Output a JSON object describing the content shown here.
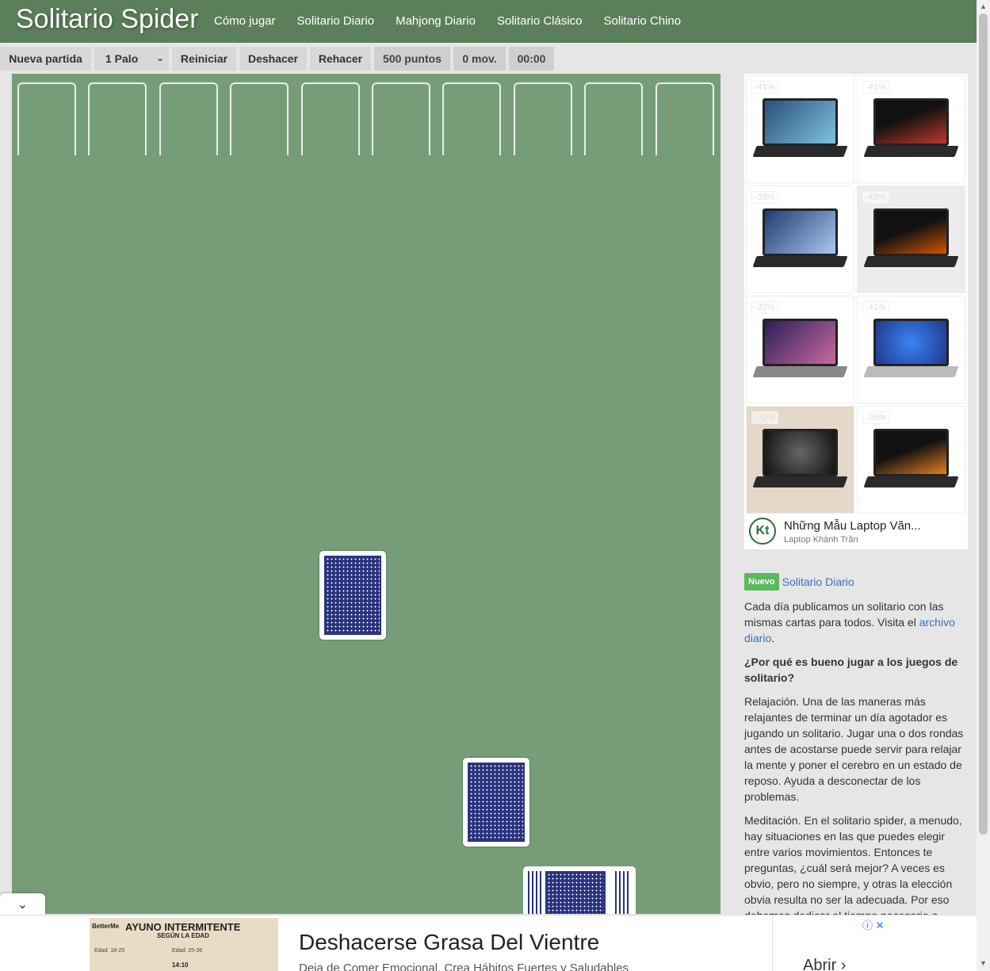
{
  "header": {
    "logo": "Solitario Spider",
    "nav": [
      "Cómo jugar",
      "Solitario Diario",
      "Mahjong Diario",
      "Solitario Clásico",
      "Solitario Chino"
    ]
  },
  "toolbar": {
    "new_game": "Nueva partida",
    "suit_select": "1 Palo",
    "restart": "Reiniciar",
    "undo": "Deshacer",
    "redo": "Rehacer",
    "score": "500 puntos",
    "moves": "0 mov.",
    "timer": "00:00"
  },
  "board": {
    "columns": 10,
    "background": "#779d78",
    "card_back": "#2a3480"
  },
  "side_ad": {
    "discounts": [
      "-41%",
      "-41%",
      "-38%",
      "-43%",
      "-37%",
      "-41%",
      "-32%",
      "-35%"
    ],
    "title": "Những Mẫu Laptop Văn...",
    "advertiser": "Laptop Khánh Trần",
    "logo_text": "Kt"
  },
  "article": {
    "badge": "Nuevo",
    "link_title": "Solitario Diario",
    "intro_before": "Cada día publicamos un solitario con las mismas cartas para todos. Visita el ",
    "intro_link": "archivo diario",
    "intro_after": ".",
    "heading": "¿Por qué es bueno jugar a los juegos de solitario?",
    "p1": "Relajación. Una de las maneras más relajantes de terminar un día agotador es jugando un solitario. Jugar una o dos rondas antes de acostarse puede servir para relajar la mente y poner el cerebro en un estado de reposo. Ayuda a desconectar de los problemas.",
    "p2": "Meditación. En el solitario spider, a menudo, hay situaciones en las que puedes elegir entre varios movimientos. Entonces te preguntas, ¿cuál será mejor? A veces es obvio, pero no siempre, y otras la elección obvia resulta no ser la adecuada. Por eso debemos dedicar el tiempo necesario a"
  },
  "bottom_ad": {
    "image_brand": "BetterMe",
    "image_headline": "AYUNO INTERMITENTE",
    "image_subheadline": "SEGÚN LA EDAD",
    "image_age_1": "Edad: 18-25",
    "image_age_2": "Edad: 25-35",
    "image_time": "14:10",
    "headline": "Deshacerse Grasa Del Vientre",
    "description": "Deja de Comer Emocional, Crea Hábitos Fuertes y Saludables",
    "cta": "Abrir",
    "cta_icon": "chevron-right-icon"
  }
}
